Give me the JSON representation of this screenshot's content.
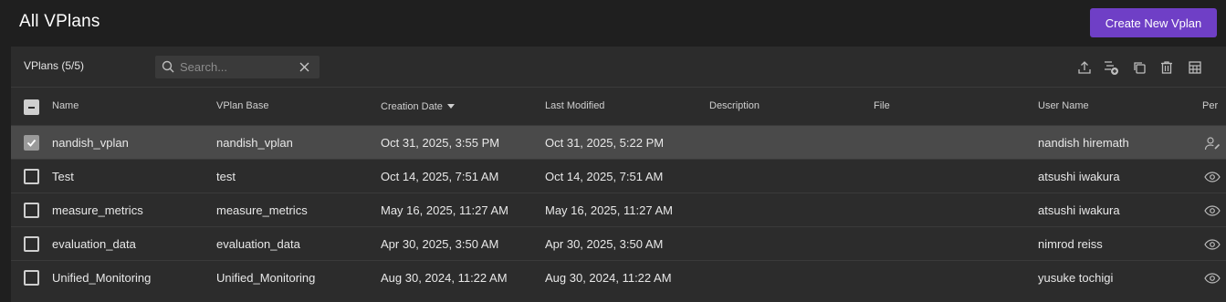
{
  "header": {
    "title": "All VPlans",
    "create_label": "Create New Vplan"
  },
  "toolbar": {
    "count_label": "VPlans (5/5)",
    "search_placeholder": "Search...",
    "icons": [
      "export-icon",
      "add-filter-icon",
      "copy-icon",
      "delete-icon",
      "columns-icon"
    ]
  },
  "columns": [
    {
      "label": "Name"
    },
    {
      "label": "VPlan Base"
    },
    {
      "label": "Creation Date",
      "sorted": "desc"
    },
    {
      "label": "Last Modified"
    },
    {
      "label": "Description"
    },
    {
      "label": "File"
    },
    {
      "label": "User Name"
    },
    {
      "label": "Per"
    }
  ],
  "rows": [
    {
      "name": "nandish_vplan",
      "base": "nandish_vplan",
      "created": "Oct 31, 2025, 3:55 PM",
      "modified": "Oct 31, 2025, 5:22 PM",
      "description": "",
      "file": "",
      "user": "nandish hiremath",
      "permission_icon": "user-edit-icon",
      "checked": true
    },
    {
      "name": "Test",
      "base": "test",
      "created": "Oct 14, 2025, 7:51 AM",
      "modified": "Oct 14, 2025, 7:51 AM",
      "description": "",
      "file": "",
      "user": "atsushi iwakura",
      "permission_icon": "eye-icon",
      "checked": false
    },
    {
      "name": "measure_metrics",
      "base": "measure_metrics",
      "created": "May 16, 2025, 11:27 AM",
      "modified": "May 16, 2025, 11:27 AM",
      "description": "",
      "file": "",
      "user": "atsushi iwakura",
      "permission_icon": "eye-icon",
      "checked": false
    },
    {
      "name": "evaluation_data",
      "base": "evaluation_data",
      "created": "Apr 30, 2025, 3:50 AM",
      "modified": "Apr 30, 2025, 3:50 AM",
      "description": "",
      "file": "",
      "user": "nimrod reiss",
      "permission_icon": "eye-icon",
      "checked": false
    },
    {
      "name": "Unified_Monitoring",
      "base": "Unified_Monitoring",
      "created": "Aug 30, 2024, 11:22 AM",
      "modified": "Aug 30, 2024, 11:22 AM",
      "description": "",
      "file": "",
      "user": "yusuke tochigi",
      "permission_icon": "eye-icon",
      "checked": false
    }
  ],
  "colors": {
    "background": "#1f1f1f",
    "panel": "#2c2c2c",
    "accent": "#6f3fc6",
    "selected_row": "#4a4a4a"
  }
}
